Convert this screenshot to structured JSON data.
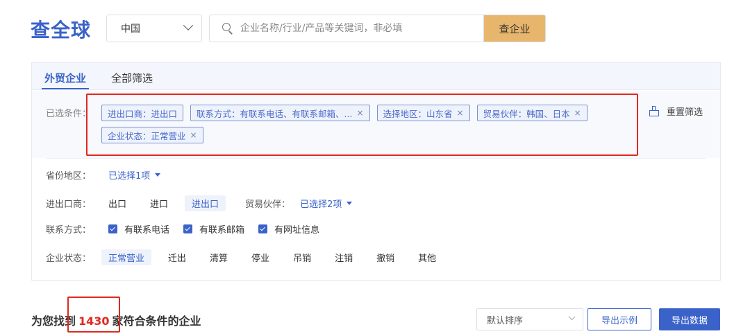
{
  "logo": "查全球",
  "country_select": {
    "value": "中国"
  },
  "search": {
    "placeholder": "企业名称/行业/产品等关键词，非必填",
    "button": "查企业"
  },
  "tabs": [
    {
      "label": "外贸企业",
      "active": true
    },
    {
      "label": "全部筛选",
      "active": false
    }
  ],
  "selected": {
    "label": "已选条件：",
    "chips": [
      {
        "text": "进出口商：进出口",
        "removable": false
      },
      {
        "text": "联系方式：有联系电话、有联系邮箱、...",
        "removable": true
      },
      {
        "text": "选择地区：山东省",
        "removable": true
      },
      {
        "text": "贸易伙伴：韩国、日本",
        "removable": true
      },
      {
        "text": "企业状态：正常营业",
        "removable": true
      }
    ],
    "remove_icon": "×",
    "reset_label": "重置筛选"
  },
  "filters": {
    "province": {
      "label": "省份地区：",
      "value": "已选择1项"
    },
    "trader": {
      "label": "进出口商：",
      "options": [
        "出口",
        "进口",
        "进出口"
      ],
      "selected": "进出口",
      "partner_label": "贸易伙伴：",
      "partner_value": "已选择2项"
    },
    "contact": {
      "label": "联系方式：",
      "options": [
        "有联系电话",
        "有联系邮箱",
        "有网址信息"
      ]
    },
    "status": {
      "label": "企业状态：",
      "options": [
        "正常营业",
        "迁出",
        "清算",
        "停业",
        "吊销",
        "注销",
        "撤销",
        "其他"
      ],
      "selected": "正常营业"
    }
  },
  "result": {
    "prefix": "为您找到",
    "count": "1430",
    "suffix": "家符合条件的企业"
  },
  "sort": {
    "value": "默认排序"
  },
  "buttons": {
    "example": "导出示例",
    "export": "导出数据"
  },
  "colors": {
    "brand": "#3a62c9",
    "accent": "#e8b56c",
    "highlight": "#e0281f"
  }
}
